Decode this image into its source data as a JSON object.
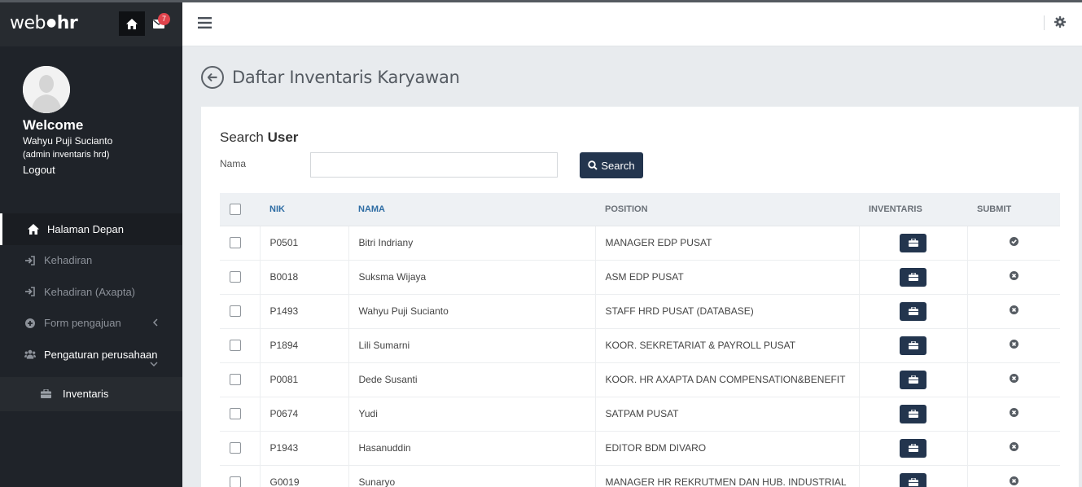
{
  "brand": {
    "logo_light": "web",
    "logo_bold": "hr",
    "mail_count": "7"
  },
  "profile": {
    "welcome": "Welcome",
    "name": "Wahyu Puji Sucianto",
    "role": "(admin inventaris hrd)",
    "logout": "Logout"
  },
  "menu": {
    "items": [
      {
        "label": "Halaman Depan",
        "icon": "home-icon"
      },
      {
        "label": "Kehadiran",
        "icon": "sign-in-icon"
      },
      {
        "label": "Kehadiran (Axapta)",
        "icon": "sign-in-icon"
      },
      {
        "label": "Form pengajuan",
        "icon": "plus-circle-icon"
      },
      {
        "label": "Pengaturan perusahaan",
        "icon": "users-icon"
      }
    ],
    "submenu": {
      "label": "Inventaris",
      "icon": "briefcase-icon"
    }
  },
  "page": {
    "title": "Daftar Inventaris Karyawan"
  },
  "search": {
    "title_light": "Search",
    "title_bold": "User",
    "nama_label": "Nama",
    "nama_value": "",
    "button": "Search"
  },
  "table": {
    "headers": {
      "nik": "NIK",
      "nama": "NAMA",
      "position": "POSITION",
      "inventaris": "INVENTARIS",
      "submit": "SUBMIT"
    },
    "rows": [
      {
        "nik": "P0501",
        "nama": "Bitri Indriany",
        "position": "MANAGER EDP PUSAT",
        "submitted": true
      },
      {
        "nik": "B0018",
        "nama": "Suksma Wijaya",
        "position": "ASM EDP PUSAT",
        "submitted": false
      },
      {
        "nik": "P1493",
        "nama": "Wahyu Puji Sucianto",
        "position": "STAFF HRD PUSAT (DATABASE)",
        "submitted": false
      },
      {
        "nik": "P1894",
        "nama": "Lili Sumarni",
        "position": "KOOR. SEKRETARIAT & PAYROLL PUSAT",
        "submitted": false
      },
      {
        "nik": "P0081",
        "nama": "Dede Susanti",
        "position": "KOOR. HR AXAPTA DAN COMPENSATION&BENEFIT",
        "submitted": false
      },
      {
        "nik": "P0674",
        "nama": "Yudi",
        "position": "SATPAM PUSAT",
        "submitted": false
      },
      {
        "nik": "P1943",
        "nama": "Hasanuddin",
        "position": "EDITOR BDM DIVARO",
        "submitted": false
      },
      {
        "nik": "G0019",
        "nama": "Sunaryo",
        "position": "MANAGER HR REKRUTMEN DAN HUB. INDUSTRIAL",
        "submitted": false
      }
    ]
  },
  "colors": {
    "sidebar": "#1f2329",
    "accent": "#23354e",
    "badge": "#e0434c",
    "link": "#2e6da4"
  }
}
